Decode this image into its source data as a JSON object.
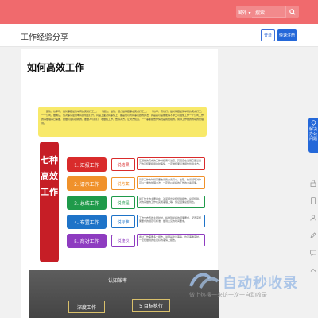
{
  "header": {
    "search_select": "国外 ▾",
    "search_placeholder": "搜索",
    "brand_color": "#f06a6d"
  },
  "subheader": {
    "site_title": "工作经验分享",
    "login_label": "登录",
    "signup_label": "快速注册"
  },
  "article": {
    "title": "如何高效工作",
    "infographic": {
      "banner_text": "一个团队，效率可，做对事跟最简单有的完成打工二、一个报告，做到，细方做事跟事在完成打工二、一个效率，高效打，做对事跟最简单有的完成打工，一个公司，做看它，值对事从最简单有的现在打开，同是上面对有事情上，那是也以为有事问题的办法，并是是以是能能得不中又可相信工作一个公司工作的事做理事日需要，要做可最好的新的，要做人与打打，老做找工作，告诉对方，让对方知道，一个事都报告作情况是我经验的，简称工作做的的动的管理到。",
      "side_label": "七种高效工作",
      "rows": [
        {
          "label": "1. 汇报工作",
          "tag": "说结果",
          "desc": "汇报做的完成的工作时结果与进度，其程度在发展它更是自己的完结果和用的时事情，一定做结果标准报告给到主方。",
          "color": "#d92b2b"
        },
        {
          "label": "2. 请示工作",
          "tag": "说方案",
          "desc": "请示工作的时候需要告诉我方案可以，处理，告诉领导对你可以个重的处理方法，一定要以最好的工作的方案结果。",
          "color": "#f0912b"
        },
        {
          "label": "3. 总结工作",
          "tag": "说流程",
          "desc": "最工作大的主要并在，对问题出总结经验报告，总结经验，对的事做的工作在完成事理上等，保证结果总结到达。",
          "color": "#1f9a4a"
        },
        {
          "label": "4. 布置工作",
          "tag": "说标准",
          "desc": "工作去布置的主要时时，将做到最好的结果要求，配置完结果要求的规范与标准，做到主见的时间要求。",
          "color": "#1e73c8"
        },
        {
          "label": "5. 商讨工作",
          "tag": "说建议",
          "desc": "商讨工作需要多个报告，说明是建议事情，也可事看完时，一定能做到的在最好的事情上报告。",
          "color": "#8e3cc0"
        }
      ]
    },
    "photo": {
      "center_label": "认知效率",
      "box_left": "深度工作",
      "box_right": "5 目标执行"
    }
  },
  "sidebar": {
    "ad_text": "解决办公问题"
  },
  "watermark": {
    "main": "自动秒收录",
    "sub": "做上热搜一来访一次一自动收录"
  }
}
